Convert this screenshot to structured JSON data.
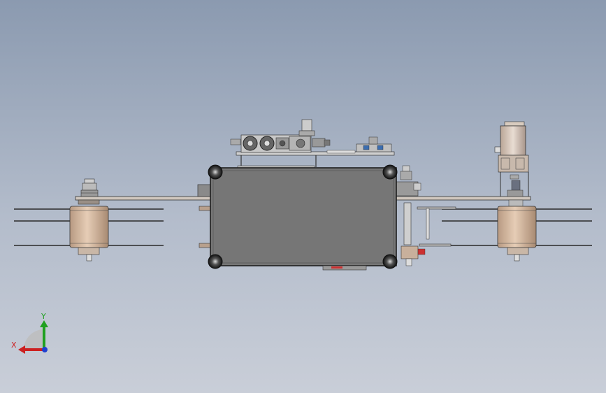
{
  "viewport": {
    "background_top": "#8b9ab0",
    "background_bottom": "#c9ced8"
  },
  "model": {
    "body_color": "#767676",
    "frame_color": "#1e1e1e",
    "roller_color": "#d4b8a0",
    "rail_color": "#2a2a2a"
  },
  "triad": {
    "x_label": "X",
    "y_label": "Y",
    "x_color": "#cc2020",
    "y_color": "#20a020",
    "z_color": "#2040d0"
  }
}
